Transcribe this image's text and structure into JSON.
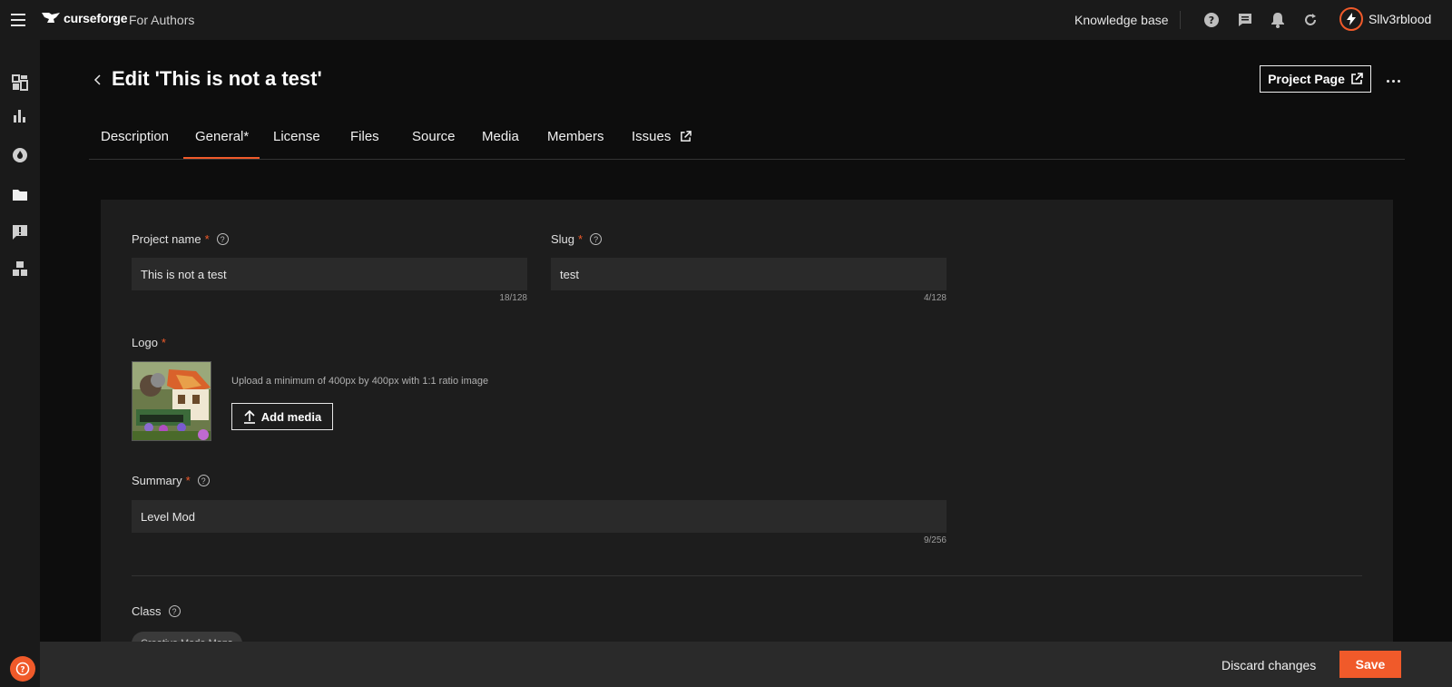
{
  "topbar": {
    "brand": "curseforge",
    "brand_sub": "For Authors",
    "knowledge_base": "Knowledge base",
    "username": "Sllv3rblood"
  },
  "sidebar": {
    "items": [
      "dashboard-icon",
      "stats-icon",
      "flame-icon",
      "folder-icon",
      "report-icon",
      "blocks-icon"
    ]
  },
  "header": {
    "title": "Edit 'This is not a test'",
    "project_page": "Project Page"
  },
  "tabs": [
    {
      "label": "Description"
    },
    {
      "label": "General*",
      "active": true
    },
    {
      "label": "License"
    },
    {
      "label": "Files"
    },
    {
      "label": "Source"
    },
    {
      "label": "Media"
    },
    {
      "label": "Members"
    },
    {
      "label": "Issues"
    }
  ],
  "form": {
    "project_name": {
      "label": "Project name",
      "value": "This is not a test",
      "counter": "18/128"
    },
    "slug": {
      "label": "Slug",
      "value": "test",
      "counter": "4/128"
    },
    "logo": {
      "label": "Logo",
      "hint": "Upload a minimum of 400px by 400px with 1:1 ratio image",
      "button": "Add media"
    },
    "summary": {
      "label": "Summary",
      "value": "Level Mod",
      "counter": "9/256"
    },
    "class": {
      "label": "Class",
      "chip": "Creative Mode Maps"
    }
  },
  "footer": {
    "discard": "Discard changes",
    "save": "Save"
  },
  "colors": {
    "accent": "#f05a2a",
    "background": "#0d0d0d",
    "panel": "#1d1d1d"
  }
}
